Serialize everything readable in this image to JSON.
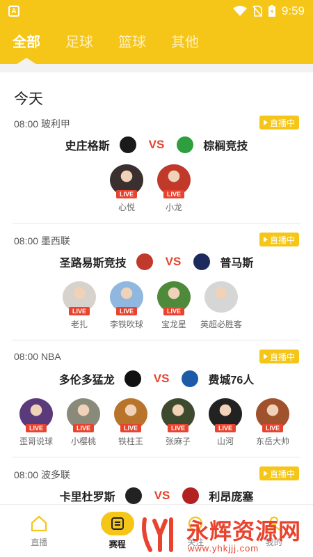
{
  "status": {
    "time": "9:59"
  },
  "tabs": [
    {
      "label": "全部",
      "active": true
    },
    {
      "label": "足球",
      "active": false
    },
    {
      "label": "篮球",
      "active": false
    },
    {
      "label": "其他",
      "active": false
    }
  ],
  "day_title": "今天",
  "live_label": "直播中",
  "vs_label": "VS",
  "avatar_live_label": "LIVE",
  "matches": [
    {
      "time": "08:00",
      "league": "玻利甲",
      "home": "史庄格斯",
      "away": "棕榈竞技",
      "home_color": "#1a1a1a",
      "away_color": "#2e9e3e",
      "hosts": [
        {
          "name": "心悦",
          "color": "#3a3030"
        },
        {
          "name": "小龙",
          "color": "#c0392b"
        }
      ]
    },
    {
      "time": "08:00",
      "league": "墨西联",
      "home": "圣路易斯竞技",
      "away": "普马斯",
      "home_color": "#c0392b",
      "away_color": "#1b2b5e",
      "hosts": [
        {
          "name": "老扎",
          "color": "#d8d2cc"
        },
        {
          "name": "李铁吹球",
          "color": "#8fb7e0"
        },
        {
          "name": "宝龙星",
          "color": "#4f8a3b"
        },
        {
          "name": "英超必胜客",
          "color": "#d6d6d6"
        }
      ]
    },
    {
      "time": "08:00",
      "league": "NBA",
      "home": "多伦多猛龙",
      "away": "费城76人",
      "home_color": "#111111",
      "away_color": "#1d5aa8",
      "hosts": [
        {
          "name": "歪哥说球",
          "color": "#5a3a7a"
        },
        {
          "name": "小樱桃",
          "color": "#8a8a7a"
        },
        {
          "name": "铁柱王",
          "color": "#b8742a"
        },
        {
          "name": "张麻子",
          "color": "#3e4a2e"
        },
        {
          "name": "山河",
          "color": "#222222"
        },
        {
          "name": "东岳大帅",
          "color": "#a0522d"
        }
      ]
    },
    {
      "time": "08:00",
      "league": "波多联",
      "home": "卡里杜罗斯",
      "away": "利昂庞塞",
      "home_color": "#222222",
      "away_color": "#b22222",
      "hosts": []
    }
  ],
  "nav": [
    {
      "label": "直播",
      "icon": "home-icon",
      "active": false
    },
    {
      "label": "赛程",
      "icon": "schedule-icon",
      "active": true
    },
    {
      "label": "关注",
      "icon": "follow-icon",
      "active": false
    },
    {
      "label": "我的",
      "icon": "profile-icon",
      "active": false
    }
  ],
  "watermark": {
    "text": "永辉资源网",
    "url": "www.yhkjjj.com"
  }
}
